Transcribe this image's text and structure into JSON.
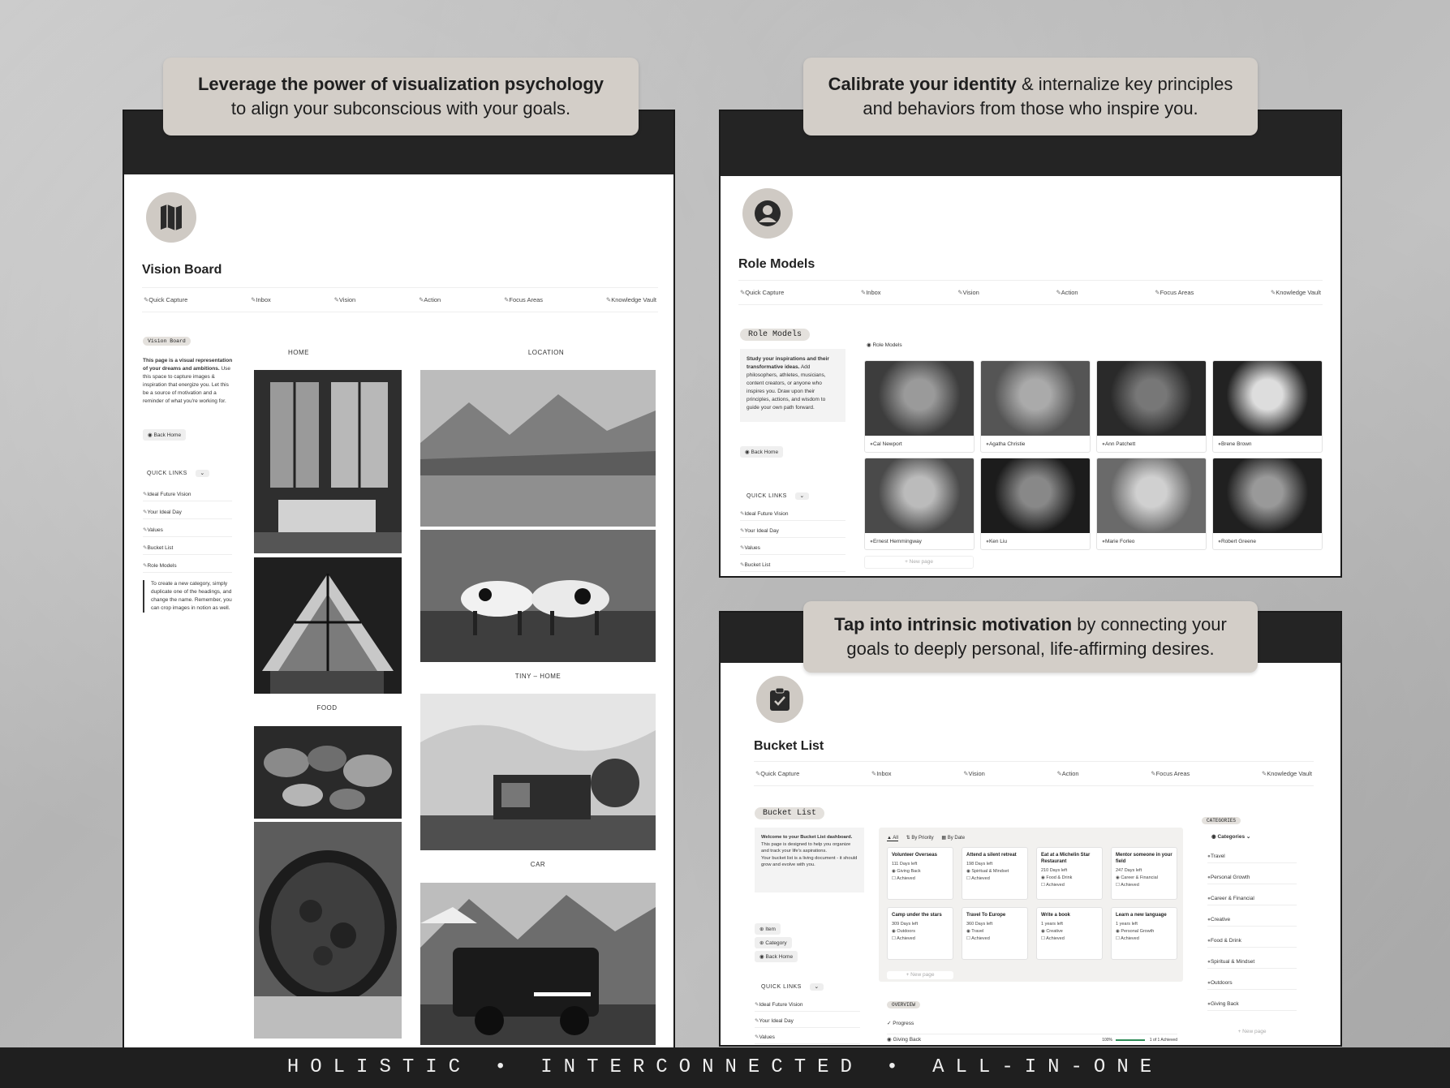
{
  "callouts": {
    "c1_bold": "Leverage the power of visualization psychology",
    "c1_rest": "to align your subconscious with your goals.",
    "c2_bold": "Calibrate your identity",
    "c2_rest": " & internalize key principles and behaviors from those who inspire you.",
    "c3_bold": "Tap into intrinsic motivation",
    "c3_rest": " by connecting your goals to deeply personal, life-affirming desires."
  },
  "nav": [
    "Quick Capture",
    "Inbox",
    "Vision",
    "Action",
    "Focus Areas",
    "Knowledge Vault"
  ],
  "vision": {
    "title": "Vision Board",
    "tag": "Vision Board",
    "desc_bold": "This page is a visual representation of your dreams and ambitions.",
    "desc_rest": " Use this space to capture images & inspiration that energize you. Let this be a source of motivation and a reminder of what you're working for.",
    "back": "Back Home",
    "quick_links": "QUICK LINKS",
    "links": [
      "Ideal Future Vision",
      "Your Ideal Day",
      "Values",
      "Bucket List",
      "Role Models"
    ],
    "tip": "To create a new category, simply duplicate one of the headings, and change the name. Remember, you can crop images in notion as well.",
    "headings": {
      "home": "HOME",
      "location": "LOCATION",
      "food": "FOOD",
      "tiny": "TINY – HOME",
      "car": "CAR"
    }
  },
  "role": {
    "title": "Role Models",
    "tag": "Role Models",
    "db": "Role Models",
    "desc_bold": "Study your inspirations and their transformative ideas.",
    "desc_rest": " Add philosophers, athletes, musicians, content creators, or anyone who inspires you. Draw upon their principles, actions, and wisdom to guide your own path forward.",
    "back": "Back Home",
    "quick_links": "QUICK LINKS",
    "links": [
      "Ideal Future Vision",
      "Your Ideal Day",
      "Values",
      "Bucket List"
    ],
    "people": [
      "Cal Newport",
      "Agatha Christie",
      "Ann Patchett",
      "Brene Brown",
      "Ernest Hemmingway",
      "Ken Liu",
      "Marie Forleo",
      "Robert Greene"
    ],
    "new_page": "+ New page"
  },
  "bucket": {
    "title": "Bucket List",
    "tag": "Bucket List",
    "welcome_bold": "Welcome to your Bucket List dashboard.",
    "welcome_1": "This page is designed to help you organize and track your life's aspirations.",
    "welcome_2": "Your bucket list is a living document - it should grow and evolve with you.",
    "buttons": [
      "Item",
      "Category",
      "Back Home"
    ],
    "quick_links": "QUICK LINKS",
    "links": [
      "Ideal Future Vision",
      "Your Ideal Day",
      "Values"
    ],
    "views": [
      "All",
      "By Priority",
      "By Date"
    ],
    "cards": [
      {
        "t": "Volunteer Overseas",
        "d": "111 Days left",
        "c": "Giving Back",
        "s": "Achieved"
      },
      {
        "t": "Attend a silent retreat",
        "d": "198 Days left",
        "c": "Spiritual & Mindset",
        "s": "Achieved"
      },
      {
        "t": "Eat at a Michelin Star Restaurant",
        "d": "210 Days left",
        "c": "Food & Drink",
        "s": "Achieved"
      },
      {
        "t": "Mentor someone in your field",
        "d": "247 Days left",
        "c": "Career & Financial",
        "s": "Achieved"
      },
      {
        "t": "Camp under the stars",
        "d": "309 Days left",
        "c": "Outdoors",
        "s": "Achieved"
      },
      {
        "t": "Travel To Europe",
        "d": "360 Days left",
        "c": "Travel",
        "s": "Achieved"
      },
      {
        "t": "Write a book",
        "d": "1 years left",
        "c": "Creative",
        "s": "Achieved"
      },
      {
        "t": "Learn a new language",
        "d": "1 years left",
        "c": "Personal Growth",
        "s": "Achieved"
      }
    ],
    "new_page": "+ New page",
    "overview": "OVERVIEW",
    "progress": "Progress",
    "giving": "Giving Back",
    "pct": "100%",
    "achieved": "1 of 1 Achieved",
    "categories_tag": "CATEGORIES",
    "categories_head": "Categories",
    "categories": [
      "Travel",
      "Personal Growth",
      "Career & Financial",
      "Creative",
      "Food & Drink",
      "Spiritual & Mindset",
      "Outdoors",
      "Giving Back"
    ]
  },
  "footer": "HOLISTIC • INTERCONNECTED • ALL-IN-ONE"
}
